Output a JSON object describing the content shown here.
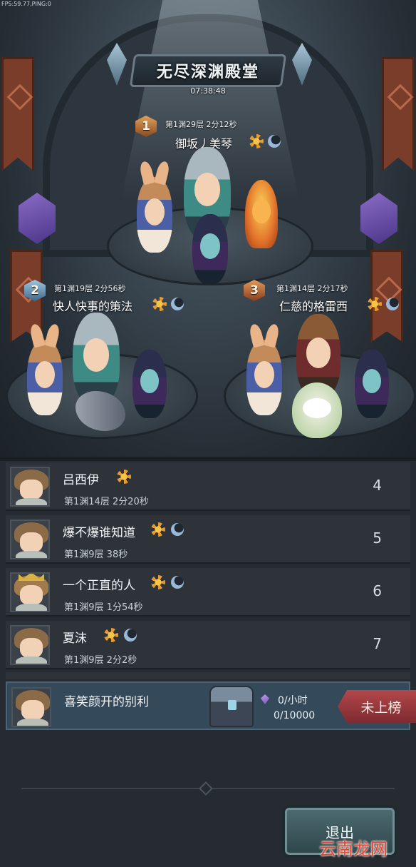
{
  "hud": {
    "fps_text": "FPS:59.77,PING:0"
  },
  "header": {
    "title": "无尽深渊殿堂",
    "timer": "07:38:48"
  },
  "podium": [
    {
      "rank": "1",
      "meta": "第1渊29层  2分12秒",
      "name": "御坂丿美琴",
      "icons": [
        "sun-icon",
        "moon-icon"
      ]
    },
    {
      "rank": "2",
      "meta": "第1渊19层  2分56秒",
      "name": "快人快事的策法",
      "icons": [
        "sun-icon",
        "moon-icon"
      ]
    },
    {
      "rank": "3",
      "meta": "第1渊14层  2分17秒",
      "name": "仁慈的格雷西",
      "icons": [
        "sun-icon",
        "moon-icon"
      ]
    }
  ],
  "list": [
    {
      "name": "吕西伊",
      "meta": "第1渊14层  2分20秒",
      "rank": "4",
      "icons": [
        "sun-icon"
      ]
    },
    {
      "name": "爆不爆谁知道",
      "meta": "第1渊9层  38秒",
      "rank": "5",
      "icons": [
        "sun-icon",
        "moon-icon"
      ]
    },
    {
      "name": "一个正直的人",
      "meta": "第1渊9层  1分54秒",
      "rank": "6",
      "icons": [
        "sun-icon",
        "moon-icon"
      ]
    },
    {
      "name": "夏沫",
      "meta": "第1渊9层  2分2秒",
      "rank": "7",
      "icons": [
        "sun-icon",
        "moon-icon"
      ]
    }
  ],
  "self": {
    "name": "喜笑颜开的别利",
    "rate": "0/小时",
    "progress": "0/10000",
    "status": "未上榜"
  },
  "footer": {
    "exit_label": "退出",
    "watermark": "云南龙网"
  },
  "colors": {
    "status_tag": "#9a3a3e",
    "self_row": "#344a5a",
    "exit_button": "#3e5a60"
  }
}
